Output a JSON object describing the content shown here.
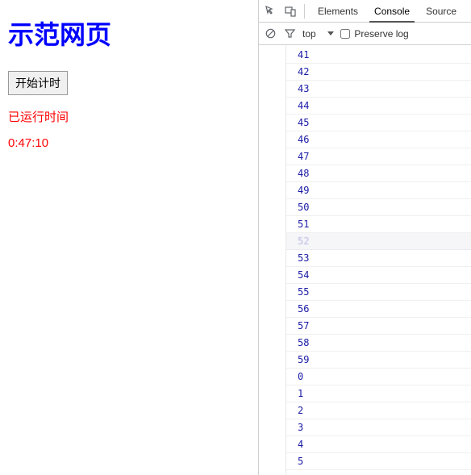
{
  "main": {
    "page_title": "示范网页",
    "start_button_label": "开始计时",
    "runtime_label": "已运行时间",
    "elapsed_time": "0:47:10"
  },
  "devtools": {
    "tabs": {
      "elements": "Elements",
      "console": "Console",
      "source_cut": "Source"
    },
    "active_tab": "console",
    "toolbar": {
      "context_label": "top",
      "preserve_label": "Preserve log",
      "preserve_checked": false
    },
    "icons": {
      "inspect": "inspect-icon",
      "device": "device-toolbar-icon",
      "clear": "clear-console-icon",
      "filter": "filter-icon",
      "dropdown": "context-dropdown-icon"
    },
    "console_log": [
      "41",
      "42",
      "43",
      "44",
      "45",
      "46",
      "47",
      "48",
      "49",
      "50",
      "51",
      "52",
      "53",
      "54",
      "55",
      "56",
      "57",
      "58",
      "59",
      "0",
      "1",
      "2",
      "3",
      "4",
      "5"
    ],
    "smudged_index": 11
  }
}
